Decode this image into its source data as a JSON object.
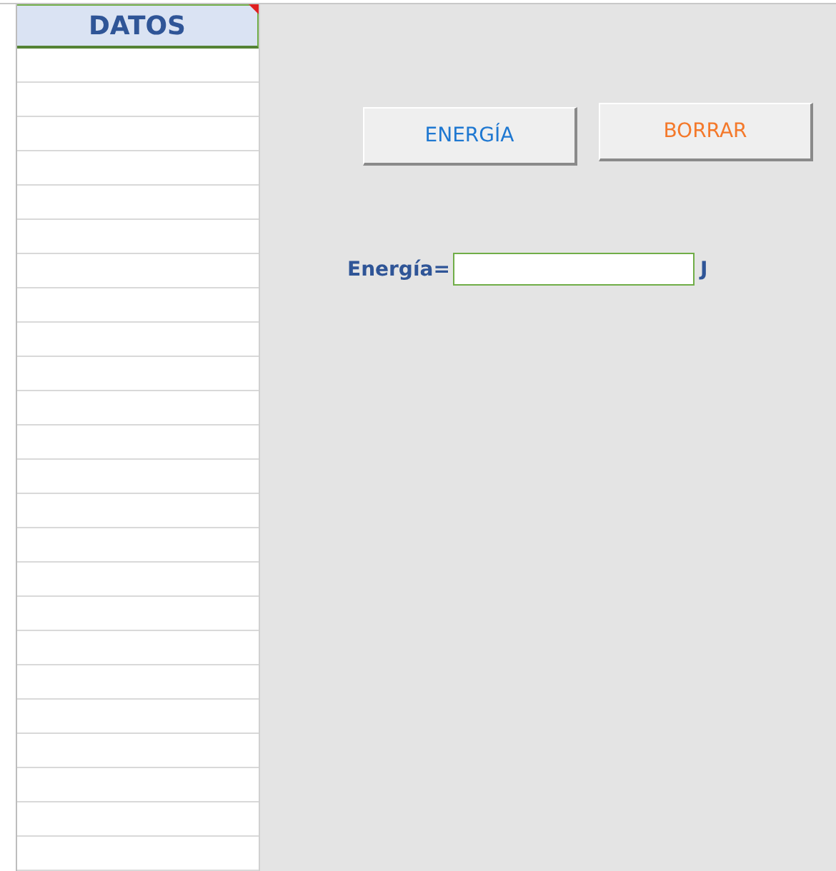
{
  "column": {
    "header": "DATOS",
    "has_comment": true
  },
  "buttons": [
    {
      "label": "ENERGÍA",
      "kind": "blue"
    },
    {
      "label": "BORRAR",
      "kind": "orange"
    }
  ],
  "result": {
    "label": "Energía=",
    "unit": "J"
  }
}
